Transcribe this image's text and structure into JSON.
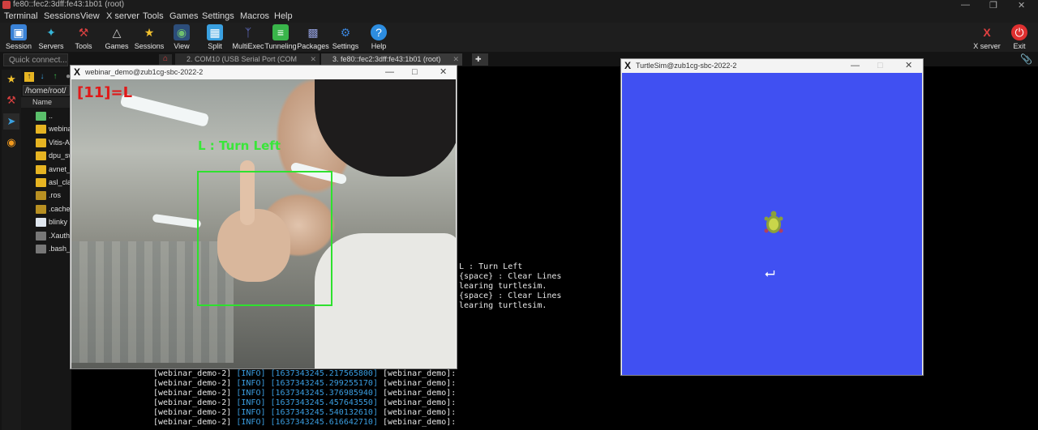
{
  "app": {
    "title": "fe80::fec2:3dff:fe43:1b01 (root)"
  },
  "menu": [
    "Terminal",
    "Sessions",
    "View",
    "X server",
    "Tools",
    "Games",
    "Settings",
    "Macros",
    "Help"
  ],
  "toolbar": [
    {
      "label": "Session",
      "icon": "session-icon",
      "color": "#3a82d6"
    },
    {
      "label": "Servers",
      "icon": "servers-icon",
      "color": "#36b5d8"
    },
    {
      "label": "Tools",
      "icon": "tools-icon",
      "color": "#d84040"
    },
    {
      "label": "Games",
      "icon": "games-icon",
      "color": "#cccccc"
    },
    {
      "label": "Sessions",
      "icon": "star-icon",
      "color": "#f2c12e"
    },
    {
      "label": "View",
      "icon": "view-icon",
      "color": "#6fbf6f"
    },
    {
      "label": "Split",
      "icon": "split-icon",
      "color": "#3aa0e0"
    },
    {
      "label": "MultiExec",
      "icon": "multiexec-icon",
      "color": "#6c7ae0"
    },
    {
      "label": "Tunneling",
      "icon": "tunneling-icon",
      "color": "#39b54a"
    },
    {
      "label": "Packages",
      "icon": "packages-icon",
      "color": "#8e9ad6"
    },
    {
      "label": "Settings",
      "icon": "settings-icon",
      "color": "#3a82d6"
    },
    {
      "label": "Help",
      "icon": "help-icon",
      "color": "#2d8de0"
    }
  ],
  "toolbar_right": [
    {
      "label": "X server",
      "icon": "xserver-icon"
    },
    {
      "label": "Exit",
      "icon": "power-icon"
    }
  ],
  "sidebar": {
    "quick_connect_placeholder": "Quick connect...",
    "path": "/home/root/",
    "column_header": "Name",
    "files": [
      {
        "name": "..",
        "type": "up"
      },
      {
        "name": "webinar",
        "type": "folder"
      },
      {
        "name": "Vitis-AI",
        "type": "folder"
      },
      {
        "name": "dpu_sw",
        "type": "folder"
      },
      {
        "name": "avnet_c",
        "type": "folder"
      },
      {
        "name": "asl_clas",
        "type": "folder"
      },
      {
        "name": ".ros",
        "type": "dfolder"
      },
      {
        "name": ".cache",
        "type": "dfolder"
      },
      {
        "name": "blinky",
        "type": "doc"
      },
      {
        "name": ".Xautho",
        "type": "gdoc"
      },
      {
        "name": ".bash_h",
        "type": "gdoc"
      }
    ]
  },
  "tabs": [
    {
      "label": "2. COM10  (USB Serial Port (COM",
      "active": false
    },
    {
      "label": "3. fe80::fec2:3dff:fe43:1b01 (root)",
      "active": true
    }
  ],
  "terminal": {
    "right_lines": [
      "L : Turn Left",
      "{space} : Clear Lines",
      "learing turtlesim.",
      "{space} : Clear Lines",
      "learing turtlesim."
    ],
    "log_lines": [
      {
        "node": "[webinar_demo-2]",
        "level": "[INFO]",
        "ts": "[1637343245.217565800]",
        "tail": "[webinar_demo]:"
      },
      {
        "node": "[webinar_demo-2]",
        "level": "[INFO]",
        "ts": "[1637343245.299255170]",
        "tail": "[webinar_demo]:"
      },
      {
        "node": "[webinar_demo-2]",
        "level": "[INFO]",
        "ts": "[1637343245.376985940]",
        "tail": "[webinar_demo]:"
      },
      {
        "node": "[webinar_demo-2]",
        "level": "[INFO]",
        "ts": "[1637343245.457643550]",
        "tail": "[webinar_demo]:"
      },
      {
        "node": "[webinar_demo-2]",
        "level": "[INFO]",
        "ts": "[1637343245.540132610]",
        "tail": "[webinar_demo]:"
      },
      {
        "node": "[webinar_demo-2]",
        "level": "[INFO]",
        "ts": "[1637343245.616642710]",
        "tail": "[webinar_demo]:"
      }
    ]
  },
  "webinar_window": {
    "title": "webinar_demo@zub1cg-sbc-2022-2",
    "prediction": "[11]=L",
    "action": "L : Turn Left"
  },
  "turtlesim_window": {
    "title": "TurtleSim@zub1cg-sbc-2022-2",
    "background": "#4050f2"
  }
}
